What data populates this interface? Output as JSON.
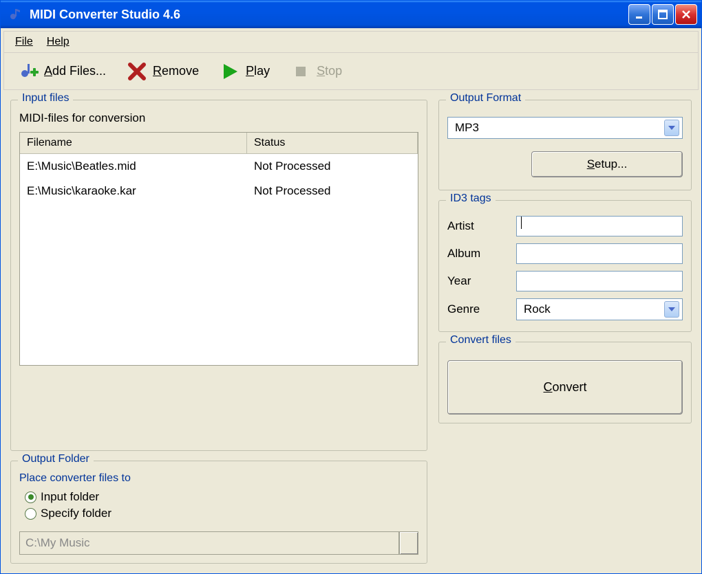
{
  "window": {
    "title": "MIDI Converter Studio 4.6"
  },
  "menubar": {
    "file": "File",
    "help": "Help"
  },
  "toolbar": {
    "add": "Add Files...",
    "remove": "Remove",
    "play": "Play",
    "stop": "Stop"
  },
  "input_files": {
    "title": "Input files",
    "subtitle": "MIDI-files for conversion",
    "columns": {
      "filename": "Filename",
      "status": "Status"
    },
    "rows": [
      {
        "filename": "E:\\Music\\Beatles.mid",
        "status": "Not Processed"
      },
      {
        "filename": "E:\\Music\\karaoke.kar",
        "status": "Not Processed"
      }
    ]
  },
  "output_folder": {
    "title": "Output Folder",
    "subtitle": "Place converter files to",
    "radio_input": "Input folder",
    "radio_specify": "Specify folder",
    "path": "C:\\My Music"
  },
  "output_format": {
    "title": "Output Format",
    "selected": "MP3",
    "setup": "Setup..."
  },
  "id3": {
    "title": "ID3 tags",
    "artist_label": "Artist",
    "album_label": "Album",
    "year_label": "Year",
    "genre_label": "Genre",
    "artist": "",
    "album": "",
    "year": "",
    "genre": "Rock"
  },
  "convert": {
    "title": "Convert files",
    "button": "Convert"
  }
}
